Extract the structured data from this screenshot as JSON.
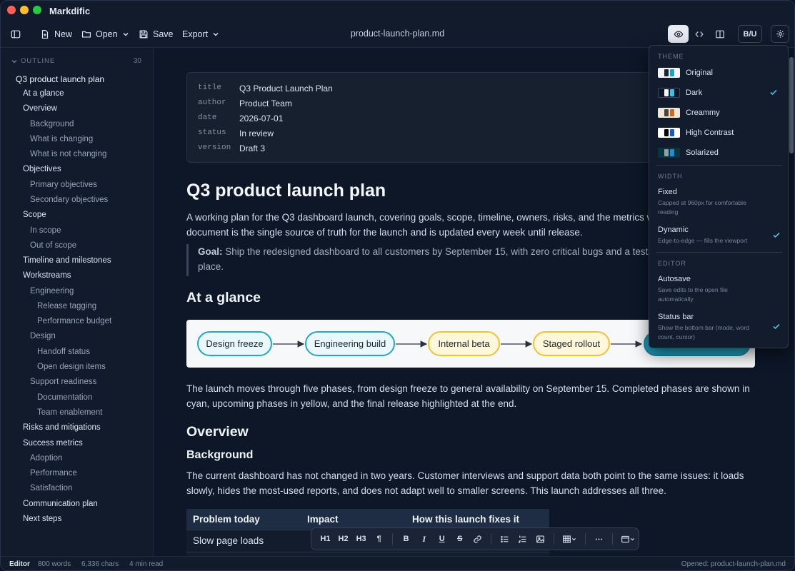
{
  "app": {
    "title": "Markdific",
    "doc_name": "product-launch-plan.md"
  },
  "toolbar": {
    "new_label": "New",
    "open_label": "Open",
    "save_label": "Save",
    "export_label": "Export",
    "format_label": "B/U"
  },
  "outline": {
    "header": "OUTLINE",
    "count": "30",
    "items": [
      {
        "label": "Q3 product launch plan"
      },
      {
        "label": "At a glance"
      },
      {
        "label": "Overview"
      },
      {
        "label": "Background"
      },
      {
        "label": "What is changing"
      },
      {
        "label": "What is not changing"
      },
      {
        "label": "Objectives"
      },
      {
        "label": "Primary objectives"
      },
      {
        "label": "Secondary objectives"
      },
      {
        "label": "Scope"
      },
      {
        "label": "In scope"
      },
      {
        "label": "Out of scope"
      },
      {
        "label": "Timeline and milestones"
      },
      {
        "label": "Workstreams"
      },
      {
        "label": "Engineering"
      },
      {
        "label": "Release tagging"
      },
      {
        "label": "Performance budget"
      },
      {
        "label": "Design"
      },
      {
        "label": "Handoff status"
      },
      {
        "label": "Open design items"
      },
      {
        "label": "Support readiness"
      },
      {
        "label": "Documentation"
      },
      {
        "label": "Team enablement"
      },
      {
        "label": "Risks and mitigations"
      },
      {
        "label": "Success metrics"
      },
      {
        "label": "Adoption"
      },
      {
        "label": "Performance"
      },
      {
        "label": "Satisfaction"
      },
      {
        "label": "Communication plan"
      },
      {
        "label": "Next steps"
      }
    ]
  },
  "frontmatter": [
    {
      "key": "title",
      "value": "Q3 Product Launch Plan"
    },
    {
      "key": "author",
      "value": "Product Team"
    },
    {
      "key": "date",
      "value": "2026-07-01"
    },
    {
      "key": "status",
      "value": "In review"
    },
    {
      "key": "version",
      "value": "Draft 3"
    }
  ],
  "doc": {
    "h1": "Q3 product launch plan",
    "intro_1": "A working plan for the Q3 dashboard launch, covering goals, scope, timeline, owners, risks, and the metrics w",
    "intro_2": "document is the single source of truth for the launch and is updated every week until release.",
    "goal_label": "Goal:",
    "goal_1": " Ship the redesigned dashboard to all customers by September 15, with zero critical bugs and a tested",
    "goal_2": "place.",
    "at_a_glance": "At a glance",
    "phases": [
      {
        "label": "Design freeze",
        "status": "done"
      },
      {
        "label": "Engineering build",
        "status": "done"
      },
      {
        "label": "Internal beta",
        "status": "upcoming"
      },
      {
        "label": "Staged rollout",
        "status": "upcoming"
      },
      {
        "label": "",
        "status": "final"
      }
    ],
    "phases_1": "The launch moves through five phases, from design freeze to general availability on September 15. Completed phases are shown in",
    "phases_2": "cyan, upcoming phases in yellow, and the final release highlighted at the end.",
    "overview": "Overview",
    "background": "Background",
    "bg_1": "The current dashboard has not changed in two years. Customer interviews and support data both point to the same issues: it loads",
    "bg_2": "slowly, hides the most-used reports, and does not adapt well to smaller screens. This launch addresses all three.",
    "table_headers": [
      "Problem today",
      "Impact",
      "How this launch fixes it"
    ],
    "table_rows": [
      [
        "Slow page loads",
        "",
        ""
      ],
      [
        "",
        "",
        ""
      ]
    ]
  },
  "format_bar": {
    "h1": "H1",
    "h2": "H2",
    "h3": "H3",
    "para": "¶",
    "bold": "B",
    "italic": "I",
    "underline": "U",
    "strike": "S"
  },
  "menu": {
    "theme_header": "THEME",
    "themes": [
      {
        "label": "Original",
        "colors": [
          "#f4f4f4",
          "#1d2533",
          "#1aa3c2"
        ],
        "selected": false
      },
      {
        "label": "Dark",
        "colors": [
          "#0d1728",
          "#f4f4f4",
          "#37c3e3"
        ],
        "selected": true
      },
      {
        "label": "Creammy",
        "colors": [
          "#efe7da",
          "#4d4438",
          "#c96a22"
        ],
        "selected": false
      },
      {
        "label": "High Contrast",
        "colors": [
          "#ffffff",
          "#000000",
          "#1956d8"
        ],
        "selected": false
      },
      {
        "label": "Solarized",
        "colors": [
          "#073642",
          "#93a1a1",
          "#268bd2"
        ],
        "selected": false
      }
    ],
    "width_header": "WIDTH",
    "width_options": [
      {
        "title": "Fixed",
        "desc": "Capped at 960px for comfortable reading",
        "checked": false
      },
      {
        "title": "Dynamic",
        "desc": "Edge-to-edge — fills the viewport",
        "checked": true
      }
    ],
    "editor_header": "EDITOR",
    "editor_options": [
      {
        "title": "Autosave",
        "desc": "Save edits to the open file automatically",
        "checked": false
      },
      {
        "title": "Status bar",
        "desc": "Show the bottom bar (mode, word count, cursor)",
        "checked": true
      }
    ]
  },
  "statusbar": {
    "mode": "Editor",
    "words": "800 words",
    "chars": "6,336 chars",
    "read": "4 min read",
    "opened": "Opened: product-launch-plan.md"
  },
  "colors": {
    "accent": "#22a7c5",
    "upcoming": "#f2c232",
    "background": "#0d1728"
  }
}
